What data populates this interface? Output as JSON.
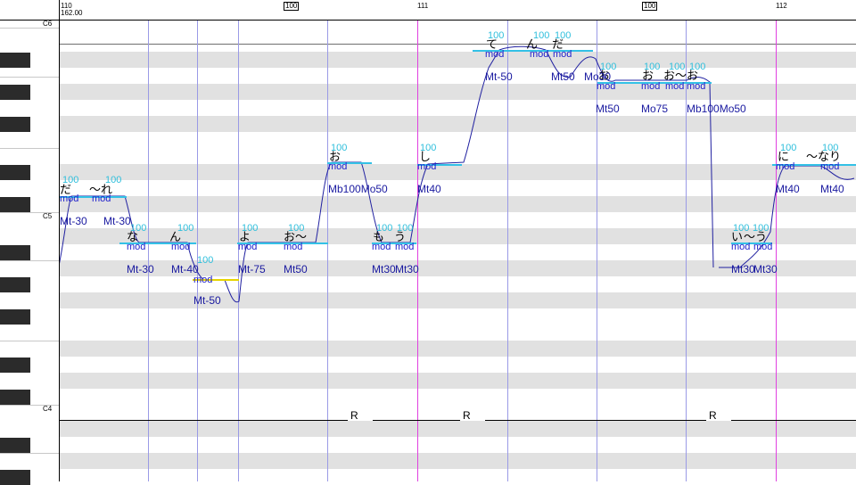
{
  "ruler": {
    "bar_start": "110",
    "tempo": "162.00",
    "marks": [
      "100",
      "111",
      "100",
      "112"
    ]
  },
  "octaves": [
    "C6",
    "C5",
    "C4"
  ],
  "colors": {
    "bar": "#e040e0",
    "beat": "#9a9ae6",
    "note": "#33c1e6",
    "pitch": "#2020a0",
    "selected": "#e6d300"
  },
  "notes": [
    {
      "lyric": "だ",
      "vel": "100",
      "mod": "mod",
      "eff": "Mt-30"
    },
    {
      "lyric": "〜れ",
      "vel": "100",
      "mod": "mod",
      "eff": "Mt-30"
    },
    {
      "lyric": "な",
      "vel": "100",
      "mod": "mod",
      "eff": "Mt-30"
    },
    {
      "lyric": "ん",
      "vel": "100",
      "mod": "mod",
      "eff": "Mt-40"
    },
    {
      "lyric": "",
      "vel": "100",
      "mod": "mod",
      "eff": "Mt-50"
    },
    {
      "lyric": "よ",
      "vel": "100",
      "mod": "mod",
      "eff": "Mt-75"
    },
    {
      "lyric": "お〜",
      "vel": "100",
      "mod": "mod",
      "eff": "Mt50"
    },
    {
      "lyric": "お",
      "vel": "100",
      "mod": "mod",
      "eff": "Mb100Mo50"
    },
    {
      "lyric": "も",
      "vel": "100",
      "mod": "mod",
      "eff": "Mt30"
    },
    {
      "lyric": "う",
      "vel": "100",
      "mod": "mod",
      "eff": "Mt30"
    },
    {
      "lyric": "し",
      "vel": "100",
      "mod": "mod",
      "eff": "Mt40"
    },
    {
      "lyric": "て",
      "vel": "100",
      "mod": "mod",
      "eff": "Mt-50"
    },
    {
      "lyric": "ん",
      "vel": "100",
      "mod": "mod",
      "eff": ""
    },
    {
      "lyric": "だ",
      "vel": "100",
      "mod": "mod",
      "eff": "Mt50"
    },
    {
      "lyric": "お",
      "vel": "100",
      "mod": "mod",
      "eff": "Mo30"
    },
    {
      "lyric": "お",
      "vel": "100",
      "mod": "mod",
      "eff": "Mt50"
    },
    {
      "lyric": "お〜",
      "vel": "100",
      "mod": "mod",
      "eff": "Mo75"
    },
    {
      "lyric": "お",
      "vel": "100",
      "mod": "mod",
      "eff": "Mb100Mo50"
    },
    {
      "lyric": "い",
      "vel": "100",
      "mod": "mod",
      "eff": "Mt30"
    },
    {
      "lyric": "〜う",
      "vel": "100",
      "mod": "mod",
      "eff": "Mt30"
    },
    {
      "lyric": "に",
      "vel": "100",
      "mod": "mod",
      "eff": "Mt40"
    },
    {
      "lyric": "〜なり",
      "vel": "100",
      "mod": "mod",
      "eff": "Mt40"
    }
  ],
  "rests": [
    "R",
    "R",
    "R"
  ]
}
